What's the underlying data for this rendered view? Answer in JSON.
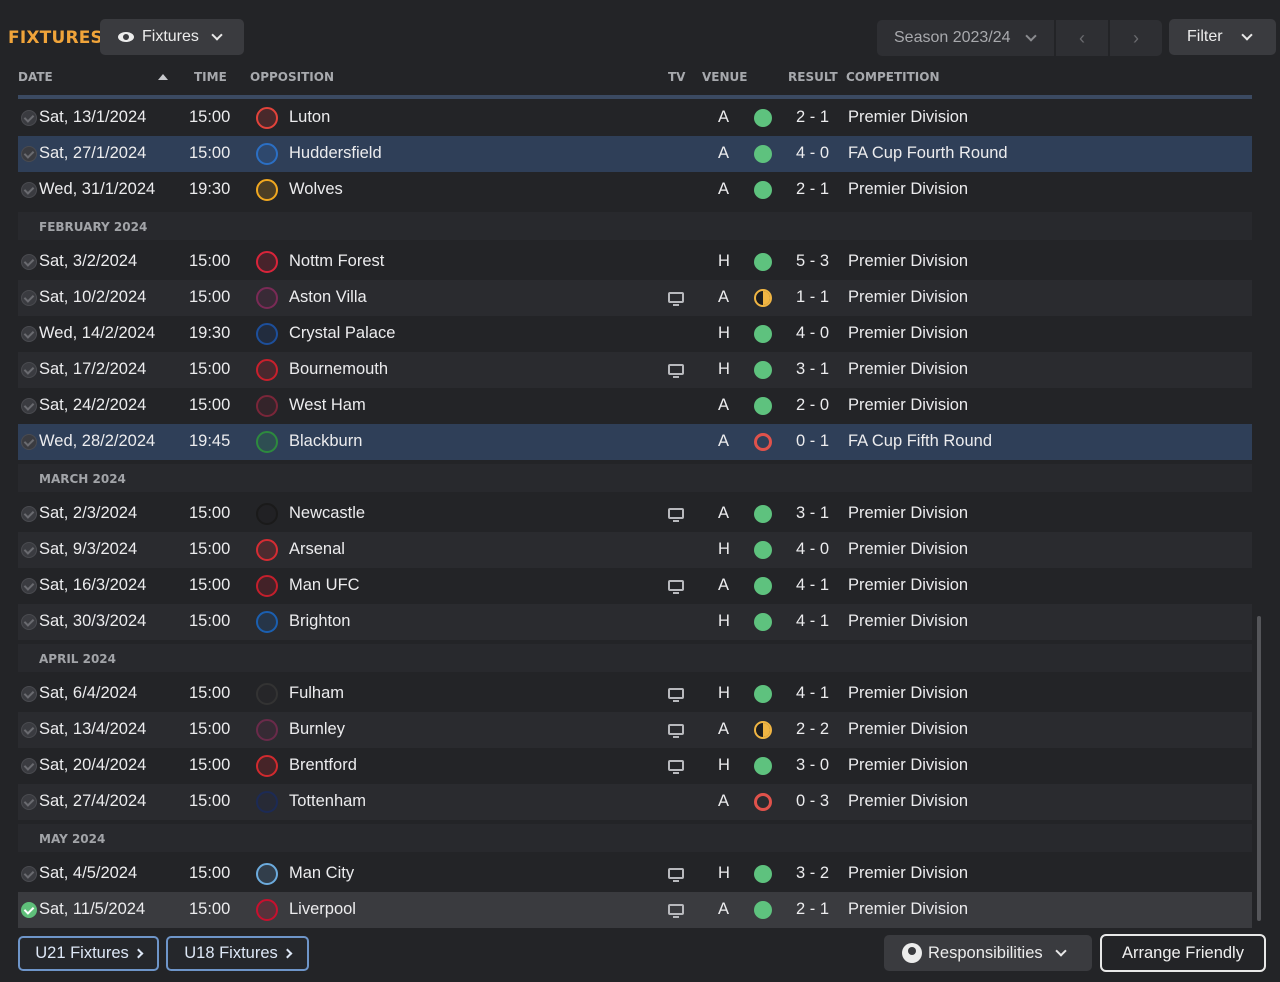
{
  "header": {
    "title": "FIXTURES",
    "view_selector": "Fixtures",
    "season": "Season 2023/24",
    "filter_label": "Filter"
  },
  "columns": {
    "date": "DATE",
    "time": "TIME",
    "opposition": "OPPOSITION",
    "tv": "TV",
    "venue": "VENUE",
    "result": "RESULT",
    "competition": "COMPETITION"
  },
  "fixtures": [
    {
      "date": "Sat, 13/1/2024",
      "time": "15:00",
      "opponent": "Luton",
      "tv": false,
      "venue": "A",
      "outcome": "W",
      "score": "2 - 1",
      "competition": "Premier Division",
      "crest_color": "#e2433b"
    },
    {
      "date": "Sat, 27/1/2024",
      "time": "15:00",
      "opponent": "Huddersfield",
      "tv": false,
      "venue": "A",
      "outcome": "W",
      "score": "4 - 0",
      "competition": "FA Cup Fourth Round",
      "crest_color": "#2b6fc4",
      "highlight": true
    },
    {
      "date": "Wed, 31/1/2024",
      "time": "19:30",
      "opponent": "Wolves",
      "tv": false,
      "venue": "A",
      "outcome": "W",
      "score": "2 - 1",
      "competition": "Premier Division",
      "crest_color": "#f1a820"
    },
    {
      "section": "FEBRUARY 2024"
    },
    {
      "date": "Sat, 3/2/2024",
      "time": "15:00",
      "opponent": "Nottm Forest",
      "tv": false,
      "venue": "H",
      "outcome": "W",
      "score": "5 - 3",
      "competition": "Premier Division",
      "crest_color": "#d9243a"
    },
    {
      "date": "Sat, 10/2/2024",
      "time": "15:00",
      "opponent": "Aston Villa",
      "tv": true,
      "venue": "A",
      "outcome": "D",
      "score": "1 - 1",
      "competition": "Premier Division",
      "crest_color": "#7a2a56"
    },
    {
      "date": "Wed, 14/2/2024",
      "time": "19:30",
      "opponent": "Crystal Palace",
      "tv": false,
      "venue": "H",
      "outcome": "W",
      "score": "4 - 0",
      "competition": "Premier Division",
      "crest_color": "#1d4f9b"
    },
    {
      "date": "Sat, 17/2/2024",
      "time": "15:00",
      "opponent": "Bournemouth",
      "tv": true,
      "venue": "H",
      "outcome": "W",
      "score": "3 - 1",
      "competition": "Premier Division",
      "crest_color": "#c8202c"
    },
    {
      "date": "Sat, 24/2/2024",
      "time": "15:00",
      "opponent": "West Ham",
      "tv": false,
      "venue": "A",
      "outcome": "W",
      "score": "2 - 0",
      "competition": "Premier Division",
      "crest_color": "#7a2639"
    },
    {
      "date": "Wed, 28/2/2024",
      "time": "19:45",
      "opponent": "Blackburn",
      "tv": false,
      "venue": "A",
      "outcome": "L",
      "score": "0 - 1",
      "competition": "FA Cup Fifth Round",
      "crest_color": "#2d8a3e",
      "highlight": true
    },
    {
      "section": "MARCH 2024"
    },
    {
      "date": "Sat, 2/3/2024",
      "time": "15:00",
      "opponent": "Newcastle",
      "tv": true,
      "venue": "A",
      "outcome": "W",
      "score": "3 - 1",
      "competition": "Premier Division",
      "crest_color": "#1a1a1a"
    },
    {
      "date": "Sat, 9/3/2024",
      "time": "15:00",
      "opponent": "Arsenal",
      "tv": false,
      "venue": "H",
      "outcome": "W",
      "score": "4 - 0",
      "competition": "Premier Division",
      "crest_color": "#d52c33"
    },
    {
      "date": "Sat, 16/3/2024",
      "time": "15:00",
      "opponent": "Man UFC",
      "tv": true,
      "venue": "A",
      "outcome": "W",
      "score": "4 - 1",
      "competition": "Premier Division",
      "crest_color": "#c41f2c"
    },
    {
      "date": "Sat, 30/3/2024",
      "time": "15:00",
      "opponent": "Brighton",
      "tv": false,
      "venue": "H",
      "outcome": "W",
      "score": "4 - 1",
      "competition": "Premier Division",
      "crest_color": "#1b5fb0"
    },
    {
      "section": "APRIL 2024"
    },
    {
      "date": "Sat, 6/4/2024",
      "time": "15:00",
      "opponent": "Fulham",
      "tv": true,
      "venue": "H",
      "outcome": "W",
      "score": "4 - 1",
      "competition": "Premier Division",
      "crest_color": "#333333"
    },
    {
      "date": "Sat, 13/4/2024",
      "time": "15:00",
      "opponent": "Burnley",
      "tv": true,
      "venue": "A",
      "outcome": "D",
      "score": "2 - 2",
      "competition": "Premier Division",
      "crest_color": "#6a2a4a"
    },
    {
      "date": "Sat, 20/4/2024",
      "time": "15:00",
      "opponent": "Brentford",
      "tv": true,
      "venue": "H",
      "outcome": "W",
      "score": "3 - 0",
      "competition": "Premier Division",
      "crest_color": "#d12a2e"
    },
    {
      "date": "Sat, 27/4/2024",
      "time": "15:00",
      "opponent": "Tottenham",
      "tv": false,
      "venue": "A",
      "outcome": "L",
      "score": "0 - 3",
      "competition": "Premier Division",
      "crest_color": "#1c2a55"
    },
    {
      "section": "MAY 2024"
    },
    {
      "date": "Sat, 4/5/2024",
      "time": "15:00",
      "opponent": "Man City",
      "tv": true,
      "venue": "H",
      "outcome": "W",
      "score": "3 - 2",
      "competition": "Premier Division",
      "crest_color": "#6cabdd"
    },
    {
      "date": "Sat, 11/5/2024",
      "time": "15:00",
      "opponent": "Liverpool",
      "tv": true,
      "venue": "A",
      "outcome": "W",
      "score": "2 - 1",
      "competition": "Premier Division",
      "crest_color": "#c8102e",
      "completed": true
    }
  ],
  "footer": {
    "u21_label": "U21 Fixtures",
    "u18_label": "U18 Fixtures",
    "responsibilities_label": "Responsibilities",
    "arrange_label": "Arrange Friendly"
  },
  "colors": {
    "accent": "#f0a43a",
    "win": "#5ec27e",
    "draw": "#f0b543",
    "loss": "#e0524b",
    "highlight_row": "#2f3f58"
  }
}
